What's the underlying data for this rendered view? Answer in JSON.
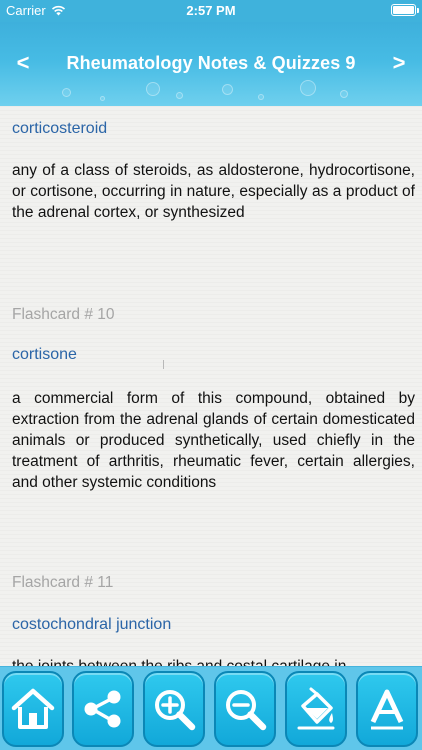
{
  "status_bar": {
    "carrier": "Carrier",
    "time": "2:57 PM"
  },
  "nav": {
    "title": "Rheumatology Notes & Quizzes 9",
    "prev": "<",
    "next": ">"
  },
  "cards": [
    {
      "term": "corticosteroid",
      "definition": "any of a class of steroids, as aldosterone, hydrocortisone, or cortisone, occurring in nature, especially as a product of the adrenal cortex, or synthesized"
    },
    {
      "label": "Flashcard # 10",
      "term": "cortisone",
      "definition": "a commercial form of this compound, obtained by extraction from the adrenal glands of certain domesticated animals or produced synthetically, used chiefly in the treatment of arthritis, rheumatic fever, certain allergies, and other systemic conditions"
    },
    {
      "label": "Flashcard # 11",
      "term": "costochondral junction",
      "definition_partial": "the joints between the ribs and costal cartilage in"
    }
  ],
  "toolbar": {
    "icons": [
      "home-icon",
      "share-icon",
      "zoom-in-icon",
      "zoom-out-icon",
      "paint-bucket-icon",
      "font-icon"
    ],
    "accent": "#12a8d9"
  }
}
